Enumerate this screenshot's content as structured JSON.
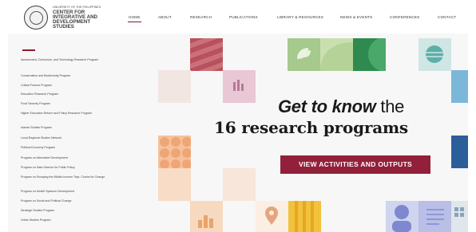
{
  "logo": {
    "small_line": "UNIVERSITY OF THE PHILIPPINES",
    "name_lines": [
      "CENTER FOR",
      "INTEGRATIVE AND",
      "DEVELOPMENT",
      "STUDIES"
    ]
  },
  "nav": [
    "HOME",
    "ABOUT",
    "RESEARCH",
    "PUBLICATIONS",
    "LIBRARY & RESOURCES",
    "NEWS & EVENTS",
    "CONFERENCES",
    "CONTACT"
  ],
  "programs": [
    "Assessment, Curriculum, and Technology Research Program",
    "Conservation and Biodiversity Program",
    "Critical Futures Program",
    "Education Research Program",
    "Food Security Program",
    "Higher Education Reform and Policy Research Program",
    "Islamic Studies Program",
    "Local-Regional Studies Network",
    "Political Economy Program",
    "Program on Alternative Development",
    "Program on Data Science for Public Policy",
    "Program on Escaping the Middle-Income Trap: Chains for Change",
    "Program on Health Systems Development",
    "Program on Social and Political Change",
    "Strategic Studies Program",
    "Urban Studies Program"
  ],
  "hero": {
    "headline_em": "Get to know",
    "headline_rest": " the",
    "headline_line2": "16 research programs",
    "cta_label": "VIEW ACTIVITIES AND OUTPUTS"
  },
  "colors": {
    "accent": "#93203a",
    "hero_bg": "#f7f7f7"
  },
  "icons": [
    "leaf-icon",
    "globe-icon",
    "bar-chart-icon",
    "location-pin-icon",
    "document-icon",
    "person-icon",
    "grid-icon"
  ]
}
